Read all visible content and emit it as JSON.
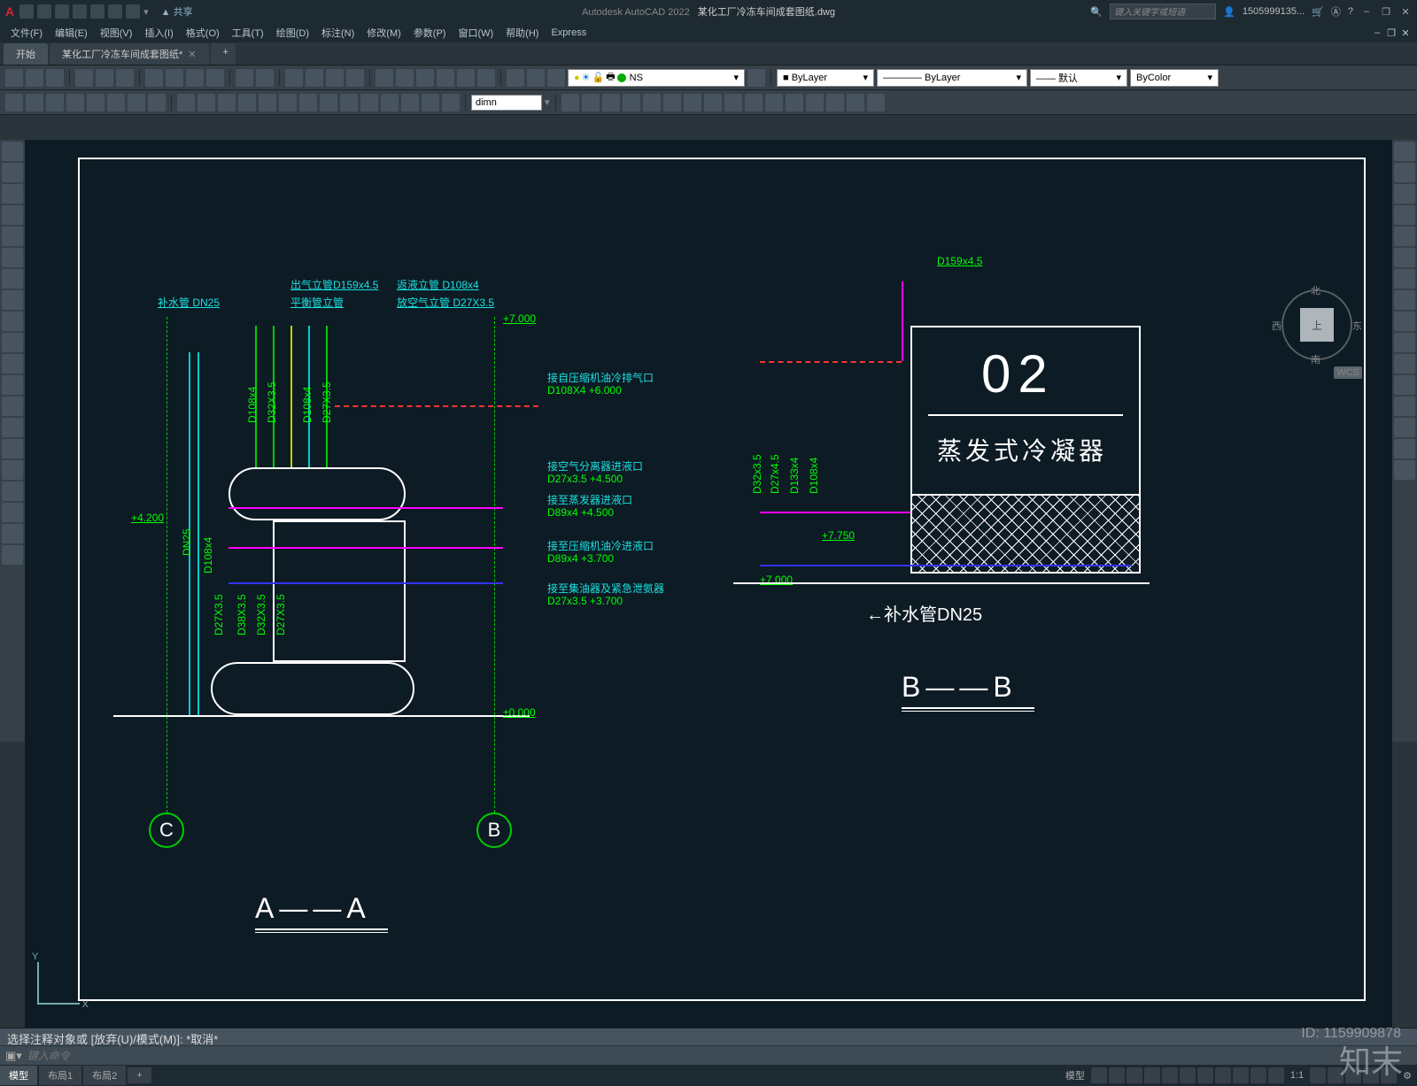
{
  "app": {
    "name": "Autodesk AutoCAD 2022",
    "file": "某化工厂冷冻车间成套图纸.dwg"
  },
  "titlebar": {
    "share": "共享",
    "search_ph": "键入关键字或短语",
    "user": "1505999135...",
    "win": {
      "min": "–",
      "max": "❐",
      "close": "✕"
    }
  },
  "menu": [
    "文件(F)",
    "编辑(E)",
    "视图(V)",
    "插入(I)",
    "格式(O)",
    "工具(T)",
    "绘图(D)",
    "标注(N)",
    "修改(M)",
    "参数(P)",
    "窗口(W)",
    "帮助(H)",
    "Express"
  ],
  "filetabs": {
    "home": "开始",
    "doc": "某化工厂冷冻车间成套图纸*",
    "plus": "+"
  },
  "props": {
    "layer": "NS",
    "color": "■ ByLayer",
    "ltype": "———— ByLayer",
    "lweight": "—— 默认",
    "plot": "ByColor",
    "dimstyle": "dimn"
  },
  "navcube": {
    "top": "上",
    "n": "北",
    "s": "南",
    "e": "东",
    "w": "西",
    "wcs": "WCS"
  },
  "drawing": {
    "sec_aa": "A——A",
    "sec_bb": "B——B",
    "bubble_b": "B",
    "bubble_c": "C",
    "left_labels": {
      "bssg": "补水管 DN25",
      "cql": "出气立管D159x4.5",
      "phg": "平衡管立管",
      "fyl": "返液立管 D108x4",
      "fkq": "放空气立管 D27X3.5"
    },
    "elev": {
      "e7": "+7.000",
      "e4200": "+4.200",
      "e0": "±0.000",
      "e7750": "+7.750",
      "e7r": "+7.000"
    },
    "verts": [
      "D108x4",
      "D32X3.5",
      "D108x4",
      "D27X3.5",
      "DN25",
      "D108x4",
      "D27X3.5",
      "D38X3.5",
      "D32X3.5",
      "D27X3.5"
    ],
    "right_notes": [
      {
        "t": "接自压缩机油冷排气口",
        "s": "D108X4 +6.000"
      },
      {
        "t": "接空气分离器进液口",
        "s": "D27x3.5 +4.500"
      },
      {
        "t": "接至蒸发器进液口",
        "s": "D89x4 +4.500"
      },
      {
        "t": "接至压缩机油冷进液口",
        "s": "D89x4 +3.700"
      },
      {
        "t": "接至集油器及紧急泄氨器",
        "s": "D27x3.5 +3.700"
      }
    ],
    "cond": {
      "num": "02",
      "name": "蒸发式冷凝器",
      "bssg": "补水管DN25",
      "d159": "D159x4.5",
      "verts": [
        "D32x3.5",
        "D27x4.5",
        "D133x4",
        "D108x4"
      ]
    }
  },
  "cmd": {
    "history": "选择注释对象或 [放弃(U)/模式(M)]: *取消*",
    "placeholder": "键入命令"
  },
  "status": {
    "tabs": [
      "模型",
      "布局1",
      "布局2"
    ],
    "plus": "+",
    "right_lbls": [
      "模型",
      "1:1"
    ],
    "gear": "⚙"
  },
  "watermark": "知末",
  "wm_id": "ID: 1159909878"
}
